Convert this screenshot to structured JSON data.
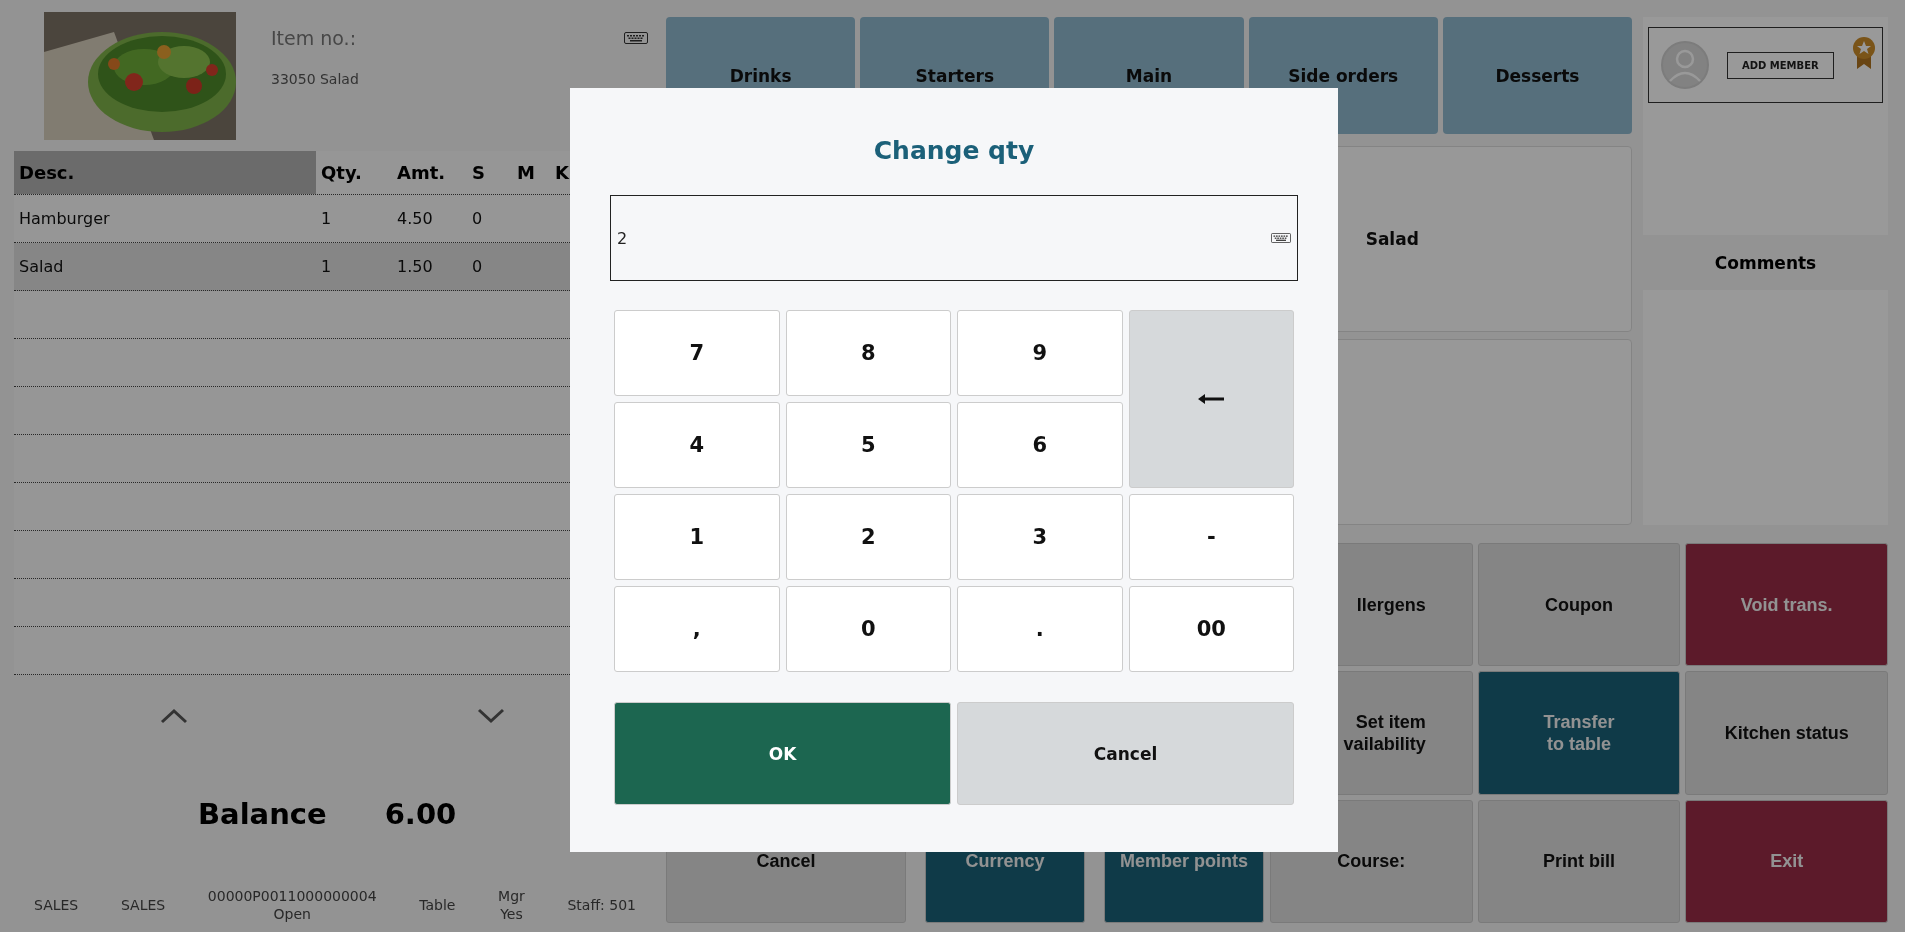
{
  "item_preview": {
    "item_no_label": "Item no.:",
    "item_name": "33050 Salad"
  },
  "order_table": {
    "columns": [
      "Desc.",
      "Qty.",
      "Amt.",
      "S",
      "M",
      "K"
    ],
    "rows": [
      {
        "cells": [
          "Hamburger",
          "1",
          "4.50",
          "0"
        ],
        "selected": false
      },
      {
        "cells": [
          "Salad",
          "1",
          "1.50",
          "0"
        ],
        "selected": true
      }
    ]
  },
  "balance": {
    "label": "Balance",
    "value": "6.00"
  },
  "status_bar": [
    {
      "lines": [
        "SALES"
      ]
    },
    {
      "lines": [
        "SALES"
      ]
    },
    {
      "lines": [
        "00000P0011000000004",
        "Open"
      ]
    },
    {
      "lines": [
        "Table"
      ]
    },
    {
      "lines": [
        "Mgr",
        "Yes"
      ]
    },
    {
      "lines": [
        "Staff: 501"
      ]
    }
  ],
  "categories": [
    "Drinks",
    "Starters",
    "Main",
    "Side orders",
    "Desserts"
  ],
  "item_tiles": [
    {
      "label": "Salad"
    }
  ],
  "member": {
    "button": "ADD MEMBER"
  },
  "comments": {
    "title": "Comments"
  },
  "actions": [
    {
      "lines": [
        "Cancel"
      ],
      "kind": "neutral"
    },
    {
      "lines": [
        "Currency"
      ],
      "kind": "teal"
    },
    {
      "lines": [
        "Member points"
      ],
      "kind": "teal"
    }
  ],
  "functions": [
    {
      "lines": [
        "llergens"
      ],
      "kind": "neutral"
    },
    {
      "lines": [
        "Coupon"
      ],
      "kind": "neutral"
    },
    {
      "lines": [
        "Void trans."
      ],
      "kind": "danger"
    },
    {
      "lines": [
        "Set item",
        "vailability"
      ],
      "kind": "neutral"
    },
    {
      "lines": [
        "Transfer",
        "to table"
      ],
      "kind": "teal"
    },
    {
      "lines": [
        "Kitchen status"
      ],
      "kind": "neutral"
    },
    {
      "lines": [
        "Course:"
      ],
      "kind": "neutral"
    },
    {
      "lines": [
        "Print bill"
      ],
      "kind": "neutral"
    },
    {
      "lines": [
        "Exit"
      ],
      "kind": "danger"
    }
  ],
  "dialog": {
    "title": "Change qty",
    "value": "2",
    "keys": [
      {
        "kind": "key",
        "label": "7"
      },
      {
        "kind": "key",
        "label": "8"
      },
      {
        "kind": "key",
        "label": "9"
      },
      {
        "kind": "backspace"
      },
      {
        "kind": "key",
        "label": "4"
      },
      {
        "kind": "key",
        "label": "5"
      },
      {
        "kind": "key",
        "label": "6"
      },
      {
        "kind": "key",
        "label": "1"
      },
      {
        "kind": "key",
        "label": "2"
      },
      {
        "kind": "key",
        "label": "3"
      },
      {
        "kind": "key",
        "label": "-"
      },
      {
        "kind": "key",
        "label": ","
      },
      {
        "kind": "key",
        "label": "0"
      },
      {
        "kind": "key",
        "label": "."
      },
      {
        "kind": "key",
        "label": "00"
      }
    ],
    "buttons": [
      {
        "label": "OK",
        "kind": "primary"
      },
      {
        "label": "Cancel",
        "kind": "secondary"
      }
    ]
  }
}
